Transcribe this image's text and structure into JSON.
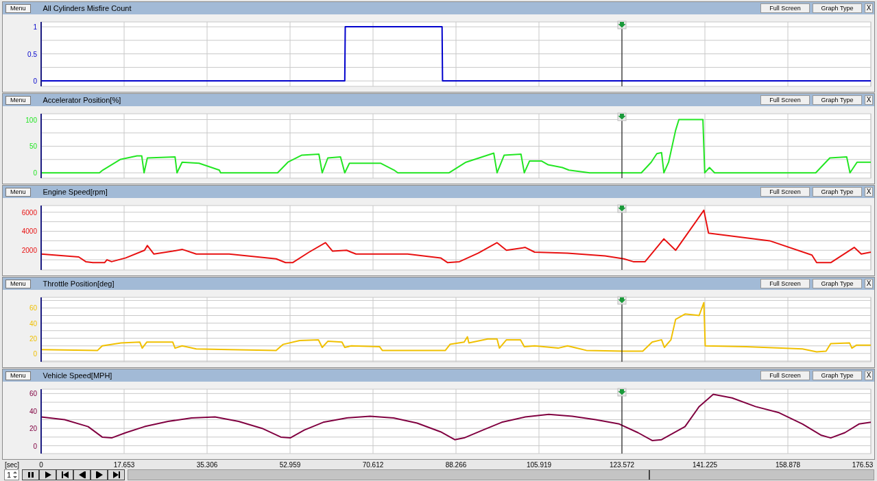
{
  "panels": [
    {
      "menu_button": "Menu",
      "buttons": [
        "Full Screen",
        "Graph Type"
      ],
      "close": "X",
      "chart_data": {
        "type": "line",
        "title": "All Cylinders Misfire Count",
        "xlim": [
          0,
          176.531
        ],
        "ylim": [
          -0.1,
          1.09
        ],
        "yticks": [
          {
            "value": 0,
            "label": "0"
          },
          {
            "value": 0.5,
            "label": "0.5"
          },
          {
            "value": 1,
            "label": "1"
          }
        ],
        "x": [
          0,
          64.6,
          64.7,
          85.3,
          85.4,
          176.531
        ],
        "series": [
          {
            "color": "#0000cc",
            "values": [
              0,
              0,
              1,
              1,
              0,
              0
            ]
          }
        ],
        "grid": true,
        "ref_lines": [
          {
            "axis": "x",
            "value": 123.572,
            "color": "#000000"
          }
        ]
      }
    },
    {
      "menu_button": "Menu",
      "buttons": [
        "Full Screen",
        "Graph Type"
      ],
      "close": "X",
      "chart_data": {
        "type": "line",
        "title": "Accelerator Position[%]",
        "xlim": [
          0,
          176.531
        ],
        "ylim": [
          -10,
          111
        ],
        "yticks": [
          {
            "value": 0,
            "label": "0"
          },
          {
            "value": 50,
            "label": "50"
          },
          {
            "value": 100,
            "label": "100"
          }
        ],
        "x": [
          0,
          12.4,
          13.1,
          16.8,
          20.4,
          21.4,
          21.9,
          22.6,
          28.5,
          28.9,
          30,
          33.6,
          37.9,
          38.2,
          50.3,
          52.5,
          55.4,
          59.1,
          59.8,
          61,
          63.7,
          64.6,
          65.6,
          72.2,
          75.1,
          75.9,
          86.8,
          90.4,
          96.3,
          97,
          98.5,
          102.1,
          102.8,
          103.9,
          106.5,
          107.9,
          110.9,
          112.3,
          116.7,
          127.7,
          129.8,
          131,
          132,
          132.5,
          133.5,
          135,
          135.7,
          140.8,
          141.2,
          142.2,
          143.3,
          164.8,
          167.8,
          171.4,
          172.1,
          173.6,
          176.531
        ],
        "series": [
          {
            "color": "#22e622",
            "values": [
              0,
              0,
              5,
              25,
              32,
              32,
              0,
              28,
              30,
              0,
              20,
              18,
              5,
              0,
              0,
              20,
              33,
              35,
              0,
              28,
              30,
              0,
              18,
              18,
              5,
              0,
              0,
              20,
              37,
              0,
              33,
              35,
              0,
              22,
              22,
              15,
              10,
              5,
              0,
              0,
              20,
              36,
              38,
              0,
              20,
              80,
              100,
              100,
              0,
              10,
              0,
              0,
              28,
              30,
              0,
              20,
              20
            ]
          }
        ],
        "grid": true,
        "ref_lines": [
          {
            "axis": "x",
            "value": 123.572,
            "color": "#000000"
          }
        ]
      }
    },
    {
      "menu_button": "Menu",
      "buttons": [
        "Full Screen",
        "Graph Type"
      ],
      "close": "X",
      "chart_data": {
        "type": "line",
        "title": "Engine Speed[rpm]",
        "xlim": [
          0,
          176.531
        ],
        "ylim": [
          -70,
          6700
        ],
        "yticks": [
          {
            "value": 2000,
            "label": "2000"
          },
          {
            "value": 4000,
            "label": "4000"
          },
          {
            "value": 6000,
            "label": "6000"
          }
        ],
        "x": [
          0,
          8,
          9.5,
          11,
          13.5,
          14,
          15,
          18,
          22,
          22.6,
          24,
          28,
          30,
          33,
          40,
          50,
          52,
          53.5,
          57,
          60.5,
          62,
          65,
          67,
          78,
          85,
          86.5,
          89,
          93,
          97,
          99,
          103,
          105,
          112,
          120,
          124,
          126,
          128.5,
          132.5,
          135,
          141,
          142,
          155,
          164,
          165,
          168,
          173,
          174.5,
          176.531
        ],
        "series": [
          {
            "color": "#e81010",
            "values": [
              1600,
              1300,
              800,
              700,
              700,
              1000,
              800,
              1200,
              2000,
              2500,
              1600,
              1900,
              2100,
              1600,
              1600,
              1100,
              700,
              700,
              1800,
              2800,
              1900,
              2000,
              1600,
              1600,
              1200,
              700,
              800,
              1700,
              2800,
              2000,
              2300,
              1800,
              1700,
              1400,
              1100,
              800,
              800,
              3200,
              2000,
              6200,
              3800,
              3000,
              1500,
              700,
              700,
              2300,
              1600,
              1800
            ]
          }
        ],
        "grid": true,
        "ref_lines": [
          {
            "axis": "x",
            "value": 123.572,
            "color": "#000000"
          }
        ]
      }
    },
    {
      "menu_button": "Menu",
      "buttons": [
        "Full Screen",
        "Graph Type"
      ],
      "close": "X",
      "chart_data": {
        "type": "line",
        "title": "Throttle Position[deg]",
        "xlim": [
          0,
          176.531
        ],
        "ylim": [
          -11,
          74
        ],
        "yticks": [
          {
            "value": 0,
            "label": "0"
          },
          {
            "value": 20,
            "label": "20"
          },
          {
            "value": 40,
            "label": "40"
          },
          {
            "value": 60,
            "label": "60"
          }
        ],
        "x": [
          0,
          12,
          13,
          17,
          21,
          21.5,
          22.5,
          28,
          28.5,
          30,
          33,
          40,
          50,
          51.5,
          55,
          59,
          59.8,
          61,
          64,
          64.6,
          66,
          72,
          72.6,
          86,
          87,
          90,
          90.7,
          91,
          95,
          97,
          97.5,
          99,
          102,
          102.8,
          105,
          110,
          112,
          116,
          124,
          128,
          130,
          132,
          132.6,
          134,
          135,
          137,
          140,
          141,
          141.3,
          150,
          162,
          165,
          167,
          168,
          172,
          172.5,
          173.5,
          176.531
        ],
        "series": [
          {
            "color": "#f0c000",
            "values": [
              5,
              4,
              10,
              14,
              15,
              7,
              15,
              15,
              7,
              10,
              6,
              5,
              4,
              12,
              17,
              18,
              8,
              16,
              15,
              8,
              10,
              9,
              4,
              4,
              12,
              15,
              22,
              14,
              19,
              19,
              7,
              18,
              18,
              9,
              10,
              7,
              10,
              4,
              3,
              3,
              15,
              18,
              8,
              18,
              45,
              52,
              50,
              67,
              10,
              9,
              6,
              2,
              3,
              13,
              14,
              7,
              11,
              11
            ]
          }
        ],
        "grid": true,
        "ref_lines": [
          {
            "axis": "x",
            "value": 123.572,
            "color": "#000000"
          }
        ]
      }
    },
    {
      "menu_button": "Menu",
      "buttons": [
        "Full Screen",
        "Graph Type"
      ],
      "close": "X",
      "chart_data": {
        "type": "line",
        "title": "Vehicle Speed[MPH]",
        "xlabel": "[sec]",
        "xlim": [
          0,
          176.531
        ],
        "ylim": [
          -9,
          65
        ],
        "xticks": [
          {
            "value": 0,
            "label": "0"
          },
          {
            "value": 17.653,
            "label": "17.653"
          },
          {
            "value": 35.306,
            "label": "35.306"
          },
          {
            "value": 52.959,
            "label": "52.959"
          },
          {
            "value": 70.612,
            "label": "70.612"
          },
          {
            "value": 88.266,
            "label": "88.266"
          },
          {
            "value": 105.919,
            "label": "105.919"
          },
          {
            "value": 123.572,
            "label": "123.572"
          },
          {
            "value": 141.225,
            "label": "141.225"
          },
          {
            "value": 158.878,
            "label": "158.878"
          },
          {
            "value": 176.531,
            "label": "176.53"
          }
        ],
        "yticks": [
          {
            "value": 0,
            "label": "0"
          },
          {
            "value": 20,
            "label": "20"
          },
          {
            "value": 40,
            "label": "40"
          },
          {
            "value": 60,
            "label": "60"
          }
        ],
        "x": [
          0,
          5,
          10,
          13,
          15,
          18,
          22,
          27,
          32,
          37,
          42,
          47,
          51,
          53,
          56,
          60,
          65,
          70,
          75,
          80,
          85,
          88,
          90,
          94,
          98,
          103,
          108,
          113,
          118,
          123,
          127,
          130,
          132,
          137,
          140,
          143,
          147,
          152,
          157,
          162,
          166,
          168,
          171,
          174,
          176.531
        ],
        "series": [
          {
            "color": "#800040",
            "values": [
              33,
              30,
              22,
              10,
              9,
              15,
              22,
              28,
              32,
              33,
              28,
              20,
              10,
              9,
              18,
              27,
              32,
              34,
              32,
              26,
              16,
              7,
              9,
              18,
              27,
              33,
              36,
              34,
              30,
              25,
              15,
              6,
              7,
              22,
              45,
              59,
              55,
              45,
              38,
              25,
              12,
              9,
              15,
              25,
              27
            ]
          }
        ],
        "grid": true,
        "ref_lines": [
          {
            "axis": "x",
            "value": 123.572,
            "color": "#000000"
          }
        ]
      }
    }
  ],
  "playback": {
    "speed": "1",
    "level": 0.7
  }
}
